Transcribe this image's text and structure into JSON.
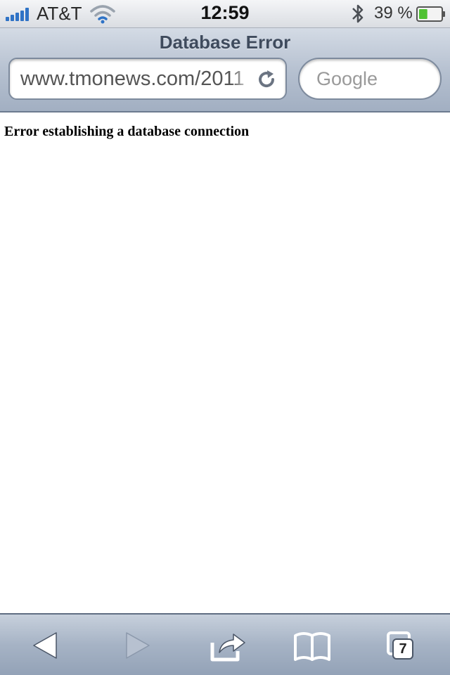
{
  "status_bar": {
    "carrier": "AT&T",
    "time": "12:59",
    "battery_percent": "39 %",
    "battery_level": 0.39,
    "signal_bars": 5,
    "icons": [
      "signal-icon",
      "wifi-icon",
      "bluetooth-icon",
      "battery-icon"
    ]
  },
  "browser": {
    "page_title": "Database Error",
    "url": "www.tmonews.com/2011",
    "search_placeholder": "Google"
  },
  "content": {
    "error_message": "Error establishing a database connection"
  },
  "toolbar": {
    "buttons": [
      "back-icon",
      "forward-icon",
      "share-icon",
      "bookmarks-icon",
      "tabs-icon"
    ],
    "tab_count": "7",
    "forward_enabled": false
  },
  "colors": {
    "signal": "#2f73c6",
    "battery_fill": "#4fc232",
    "header_text": "#3f4b5d"
  }
}
